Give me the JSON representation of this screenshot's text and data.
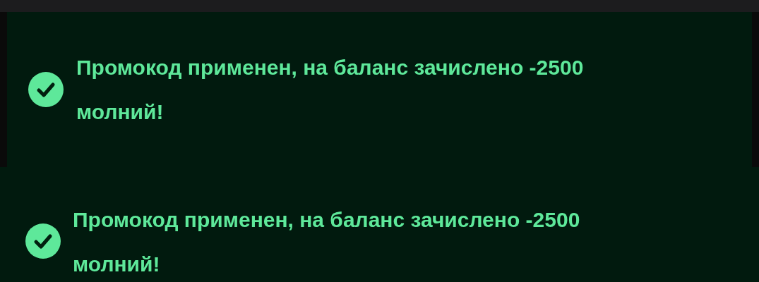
{
  "toasts": [
    {
      "kind": "success",
      "message": "Промокод применен, на баланс зачислено -2500 молний!"
    },
    {
      "kind": "success",
      "message": "Промокод применен, на баланс зачислено -2500 молний!"
    }
  ]
}
